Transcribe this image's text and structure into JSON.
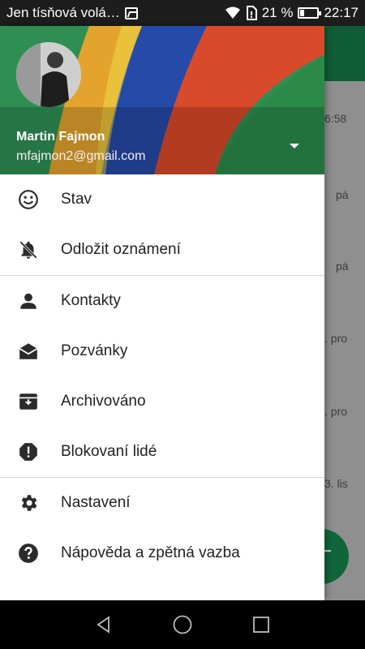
{
  "status_bar": {
    "carrier": "Jen tísňová volá…",
    "battery": "21 %",
    "battery_level": 0.21,
    "time": "22:17"
  },
  "background": {
    "timestamps": [
      "6:58",
      "pá",
      "pá",
      ". pro",
      ". pro",
      "3. lis"
    ]
  },
  "drawer": {
    "user_name": "Martin Fajmon",
    "user_email": "mfajmon2@gmail.com",
    "items": [
      {
        "label": "Stav",
        "icon": "smiley-icon"
      },
      {
        "label": "Odložit oznámení",
        "icon": "bell-off-icon"
      },
      {
        "label": "Kontakty",
        "icon": "person-icon"
      },
      {
        "label": "Pozvánky",
        "icon": "mail-open-icon"
      },
      {
        "label": "Archivováno",
        "icon": "archive-icon"
      },
      {
        "label": "Blokovaní lidé",
        "icon": "block-alert-icon"
      },
      {
        "label": "Nastavení",
        "icon": "gear-icon"
      },
      {
        "label": "Nápověda a zpětná vazba",
        "icon": "help-icon"
      }
    ]
  },
  "colors": {
    "accent": "#0f5c36",
    "icon": "#2b2b2b"
  }
}
